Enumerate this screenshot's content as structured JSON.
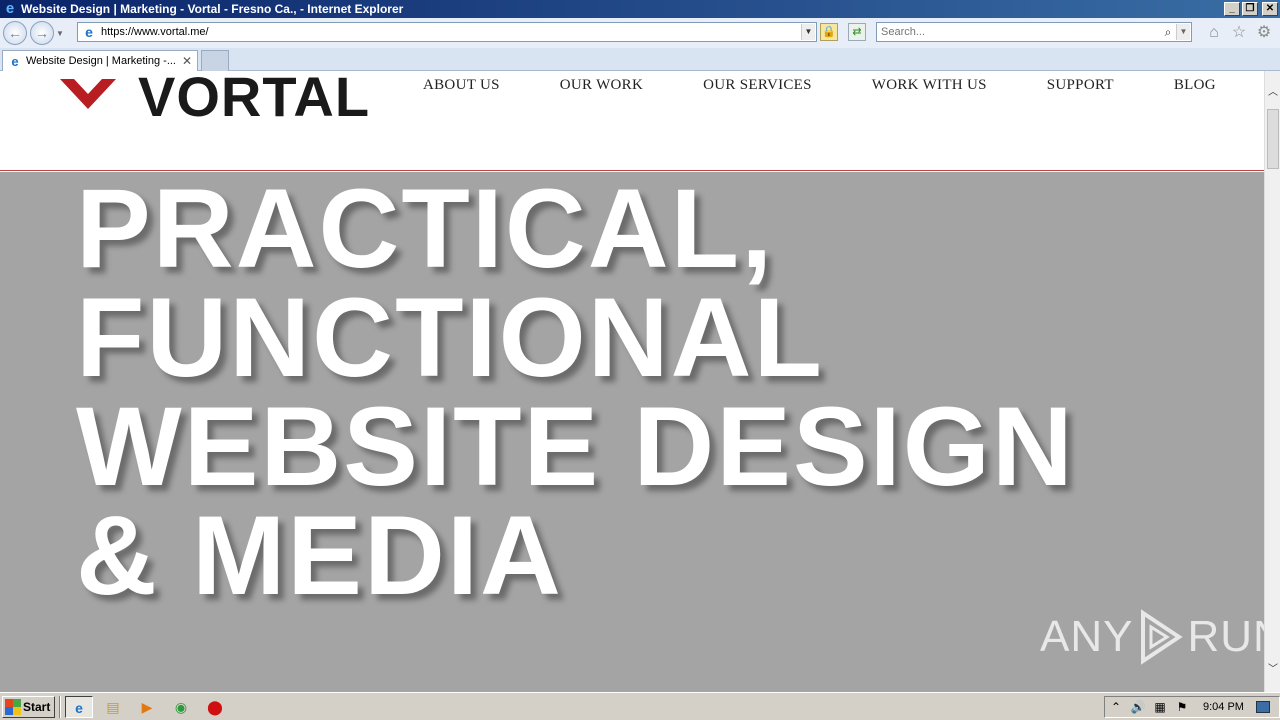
{
  "window": {
    "title": "Website Design | Marketing - Vortal - Fresno Ca., - Internet Explorer",
    "minimize": "_",
    "restore": "❐",
    "close": "✕"
  },
  "navbar": {
    "url": "https://www.vortal.me/",
    "search_placeholder": "Search...",
    "back_icon": "back-arrow-icon",
    "forward_icon": "forward-arrow-icon"
  },
  "tabs": [
    {
      "label": "Website Design | Marketing -...",
      "close": "✕"
    }
  ],
  "site": {
    "logo_text": "VORTAL",
    "menu": [
      "ABOUT US",
      "OUR WORK",
      "OUR SERVICES",
      "WORK WITH US",
      "SUPPORT",
      "BLOG"
    ],
    "hero_lines": [
      "PRACTICAL,",
      "FUNCTIONAL",
      "WEBSITE DESIGN",
      "& MEDIA"
    ],
    "accent_color": "#b81d22",
    "hero_bg": "#a4a4a4"
  },
  "watermark": {
    "left": "ANY",
    "right": "RUN"
  },
  "taskbar": {
    "start_label": "Start",
    "clock": "9:04 PM",
    "apps": [
      "internet-explorer-icon",
      "folder-icon",
      "media-player-icon",
      "chrome-icon",
      "opera-icon"
    ]
  }
}
